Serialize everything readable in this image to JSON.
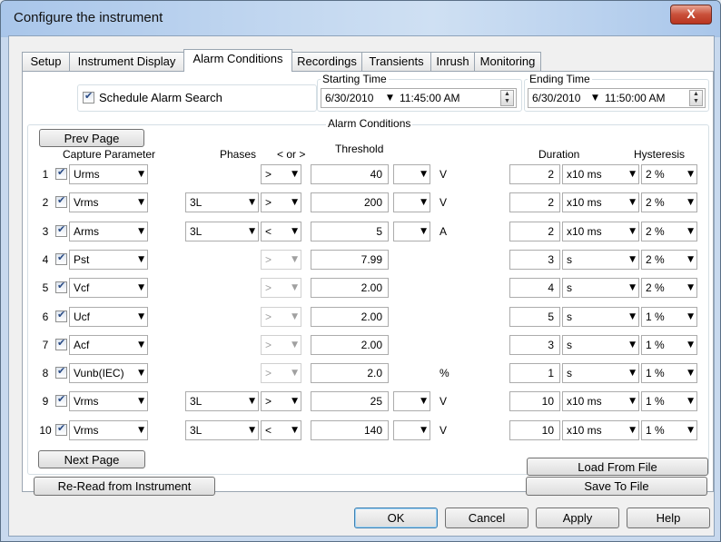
{
  "window": {
    "title": "Configure the instrument",
    "close_label": "X"
  },
  "tabs": [
    {
      "label": "Setup"
    },
    {
      "label": "Instrument Display"
    },
    {
      "label": "Alarm Conditions"
    },
    {
      "label": "Recordings"
    },
    {
      "label": "Transients"
    },
    {
      "label": "Inrush"
    },
    {
      "label": "Monitoring"
    }
  ],
  "schedule": {
    "label": "Schedule Alarm Search",
    "checked": true
  },
  "starting_time": {
    "label": "Starting Time",
    "date": "6/30/2010",
    "time": "11:45:00 AM"
  },
  "ending_time": {
    "label": "Ending Time",
    "date": "6/30/2010",
    "time": "11:50:00 AM"
  },
  "alarm_group_label": "Alarm Conditions",
  "prev_page_label": "Prev Page",
  "next_page_label": "Next Page",
  "reread_label": "Re-Read from Instrument",
  "load_label": "Load From File",
  "save_label": "Save To File",
  "headers": {
    "capture": "Capture Parameter",
    "phases": "Phases",
    "compare": "< or >",
    "threshold": "Threshold",
    "duration": "Duration",
    "hysteresis": "Hysteresis"
  },
  "rows": [
    {
      "n": "1",
      "param": "Urms",
      "phase": "",
      "cmp": ">",
      "cmp_enabled": true,
      "threshold": "40",
      "has_mult": true,
      "unit": "V",
      "duration": "2",
      "dur_unit": "x10 ms",
      "hyst": "2 %"
    },
    {
      "n": "2",
      "param": "Vrms",
      "phase": "3L",
      "cmp": ">",
      "cmp_enabled": true,
      "threshold": "200",
      "has_mult": true,
      "unit": "V",
      "duration": "2",
      "dur_unit": "x10 ms",
      "hyst": "2 %"
    },
    {
      "n": "3",
      "param": "Arms",
      "phase": "3L",
      "cmp": "<",
      "cmp_enabled": true,
      "threshold": "5",
      "has_mult": true,
      "unit": "A",
      "duration": "2",
      "dur_unit": "x10 ms",
      "hyst": "2 %"
    },
    {
      "n": "4",
      "param": "Pst",
      "phase": "",
      "cmp": ">",
      "cmp_enabled": false,
      "threshold": "7.99",
      "has_mult": false,
      "unit": "",
      "duration": "3",
      "dur_unit": "s",
      "hyst": "2 %"
    },
    {
      "n": "5",
      "param": "Vcf",
      "phase": "",
      "cmp": ">",
      "cmp_enabled": false,
      "threshold": "2.00",
      "has_mult": false,
      "unit": "",
      "duration": "4",
      "dur_unit": "s",
      "hyst": "2 %"
    },
    {
      "n": "6",
      "param": "Ucf",
      "phase": "",
      "cmp": ">",
      "cmp_enabled": false,
      "threshold": "2.00",
      "has_mult": false,
      "unit": "",
      "duration": "5",
      "dur_unit": "s",
      "hyst": "1 %"
    },
    {
      "n": "7",
      "param": "Acf",
      "phase": "",
      "cmp": ">",
      "cmp_enabled": false,
      "threshold": "2.00",
      "has_mult": false,
      "unit": "",
      "duration": "3",
      "dur_unit": "s",
      "hyst": "1 %"
    },
    {
      "n": "8",
      "param": "Vunb(IEC)",
      "phase": "",
      "cmp": ">",
      "cmp_enabled": false,
      "threshold": "2.0",
      "has_mult": false,
      "unit": "%",
      "duration": "1",
      "dur_unit": "s",
      "hyst": "1 %"
    },
    {
      "n": "9",
      "param": "Vrms",
      "phase": "3L",
      "cmp": ">",
      "cmp_enabled": true,
      "threshold": "25",
      "has_mult": true,
      "unit": "V",
      "duration": "10",
      "dur_unit": "x10 ms",
      "hyst": "1 %"
    },
    {
      "n": "10",
      "param": "Vrms",
      "phase": "3L",
      "cmp": "<",
      "cmp_enabled": true,
      "threshold": "140",
      "has_mult": true,
      "unit": "V",
      "duration": "10",
      "dur_unit": "x10 ms",
      "hyst": "1 %"
    }
  ],
  "footer": {
    "ok": "OK",
    "cancel": "Cancel",
    "apply": "Apply",
    "help": "Help"
  }
}
